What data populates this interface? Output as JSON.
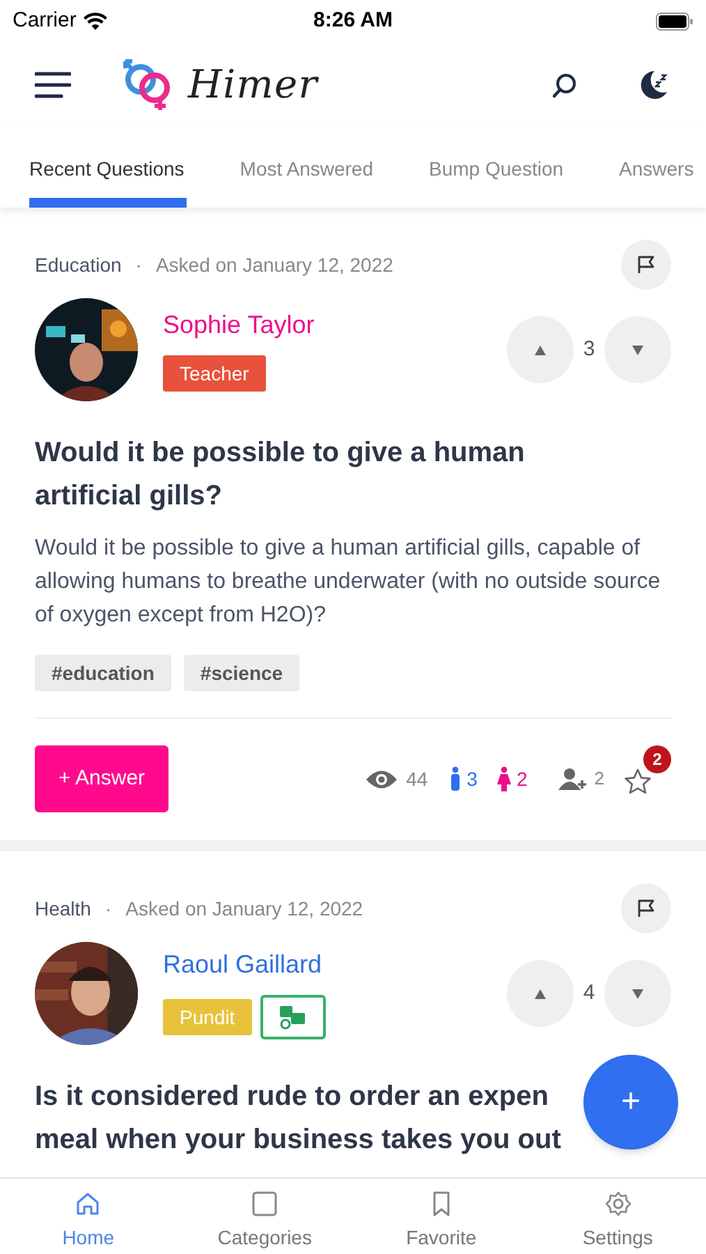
{
  "status_bar": {
    "carrier": "Carrier",
    "time": "8:26 AM"
  },
  "header": {
    "app_name": "Himer"
  },
  "tabs": [
    {
      "label": "Recent Questions",
      "selected": true
    },
    {
      "label": "Most Answered",
      "selected": false
    },
    {
      "label": "Bump Question",
      "selected": false
    },
    {
      "label": "Answers",
      "selected": false
    }
  ],
  "questions": [
    {
      "category": "Education",
      "separator": "·",
      "asked": "Asked on January 12, 2022",
      "author": {
        "name": "Sophie Taylor",
        "color": "#ec0c8c",
        "role": {
          "label": "Teacher",
          "color": "#e8513b"
        }
      },
      "votes": "3",
      "title_lines": [
        "Would it be possible to give a human",
        "artificial gills?"
      ],
      "body": "Would it be possible to give a human artificial gills, capable of allowing humans to breathe underwater (with no outside source of oxygen except from H2O)?",
      "tags": [
        "#education",
        "#science"
      ],
      "answer_button": "+ Answer",
      "stats": {
        "views": "44",
        "male": "3",
        "female": "2",
        "followers": "2",
        "favorites": "2"
      }
    },
    {
      "category": "Health",
      "separator": "·",
      "asked": "Asked on January 12, 2022",
      "author": {
        "name": "Raoul Gaillard",
        "color": "#2f6fe0",
        "role": {
          "label": "Pundit",
          "color": "#e8c23a"
        },
        "verified": true
      },
      "votes": "4",
      "title_lines": [
        "Is it considered rude to order an expen",
        "meal when your business takes you out"
      ]
    }
  ],
  "fab": {
    "label": "+"
  },
  "bottom_nav": [
    {
      "label": "Home",
      "kind": "home",
      "selected": true
    },
    {
      "label": "Categories",
      "kind": "categories",
      "selected": false
    },
    {
      "label": "Favorite",
      "kind": "favorite",
      "selected": false
    },
    {
      "label": "Settings",
      "kind": "settings",
      "selected": false
    }
  ]
}
